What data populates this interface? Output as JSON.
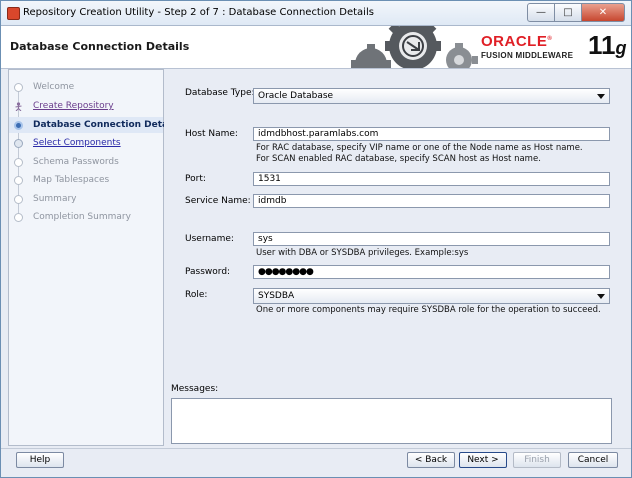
{
  "window": {
    "title": "Repository Creation Utility - Step 2 of 7 : Database Connection Details",
    "min_glyph": "—",
    "max_glyph": "□",
    "close_glyph": "✕"
  },
  "header": {
    "page_title": "Database Connection Details",
    "brand_oracle": "ORACLE",
    "brand_reg": "®",
    "brand_fusion": "FUSION MIDDLEWARE",
    "brand_version": "11",
    "brand_version_suffix": "g"
  },
  "nav": {
    "items": [
      {
        "label": "Welcome",
        "state": "done-disabled"
      },
      {
        "label": "Create Repository",
        "state": "link"
      },
      {
        "label": "Database Connection Details",
        "state": "current"
      },
      {
        "label": "Select Components",
        "state": "link"
      },
      {
        "label": "Schema Passwords",
        "state": "disabled"
      },
      {
        "label": "Map Tablespaces",
        "state": "disabled"
      },
      {
        "label": "Summary",
        "state": "disabled"
      },
      {
        "label": "Completion Summary",
        "state": "disabled"
      }
    ]
  },
  "form": {
    "db_type_label": "Database Type:",
    "db_type_value": "Oracle Database",
    "host_label": "Host Name:",
    "host_value": "idmdbhost.paramlabs.com",
    "host_hint_1": "For RAC database, specify VIP name or one of the Node name as Host name.",
    "host_hint_2": "For SCAN enabled RAC database, specify SCAN host as Host name.",
    "port_label": "Port:",
    "port_value": "1531",
    "service_label": "Service Name:",
    "service_value": "idmdb",
    "username_label": "Username:",
    "username_value": "sys",
    "username_hint": "User with DBA or SYSDBA privileges. Example:sys",
    "password_label": "Password:",
    "password_value": "●●●●●●●●",
    "role_label": "Role:",
    "role_value": "SYSDBA",
    "role_hint": "One or more components may require SYSDBA role for the operation to succeed.",
    "messages_label": "Messages:"
  },
  "buttons": {
    "help": "Help",
    "back": "< Back",
    "next": "Next >",
    "finish": "Finish",
    "cancel": "Cancel"
  }
}
